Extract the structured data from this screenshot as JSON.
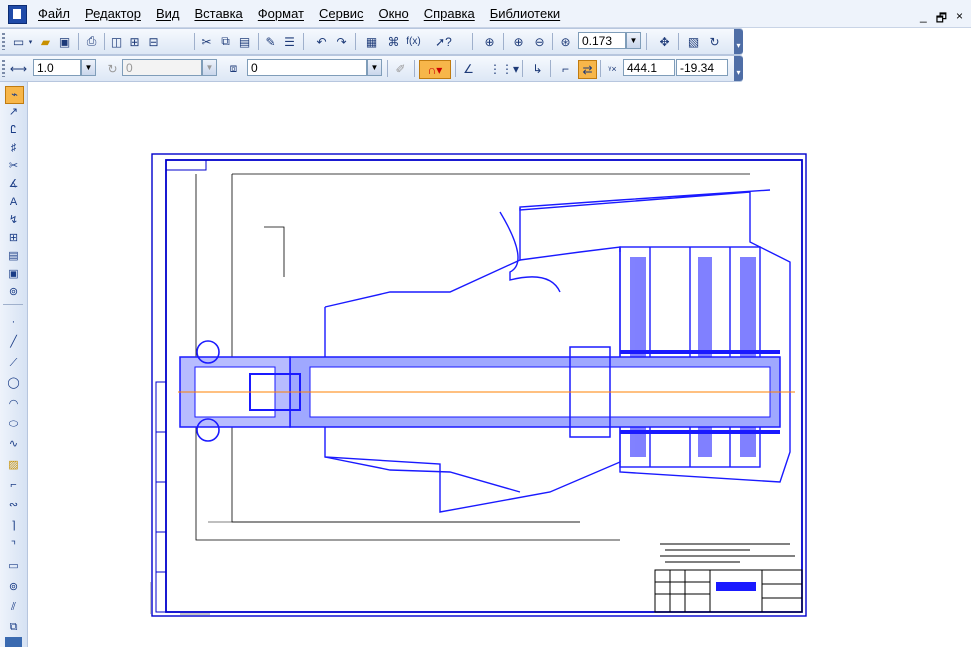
{
  "menu": {
    "items": [
      "Файл",
      "Редактор",
      "Вид",
      "Вставка",
      "Формат",
      "Сервис",
      "Окно",
      "Справка",
      "Библиотеки"
    ]
  },
  "window_controls": {
    "minimize": "_",
    "restore": "🗗",
    "close": "×"
  },
  "toolbar2": {
    "line_scale": "1.0",
    "step_value": "0",
    "layer_value": "0",
    "x_coord": "444.1",
    "y_coord": "-19.34"
  },
  "toolbar1": {
    "zoom_value": "0.173"
  },
  "icons": {
    "new": "document-new-icon",
    "open": "folder-open-icon",
    "save": "save-icon",
    "print": "print-icon",
    "cut": "cut-icon",
    "copy": "copy-icon",
    "paste": "paste-icon",
    "undo": "undo-icon",
    "redo": "redo-icon",
    "zoom": "zoom-icon",
    "pan": "pan-icon"
  },
  "colors": {
    "drawing_blue": "#1a1aff",
    "axis_orange": "#ff8000",
    "frame": "#0000cc"
  }
}
